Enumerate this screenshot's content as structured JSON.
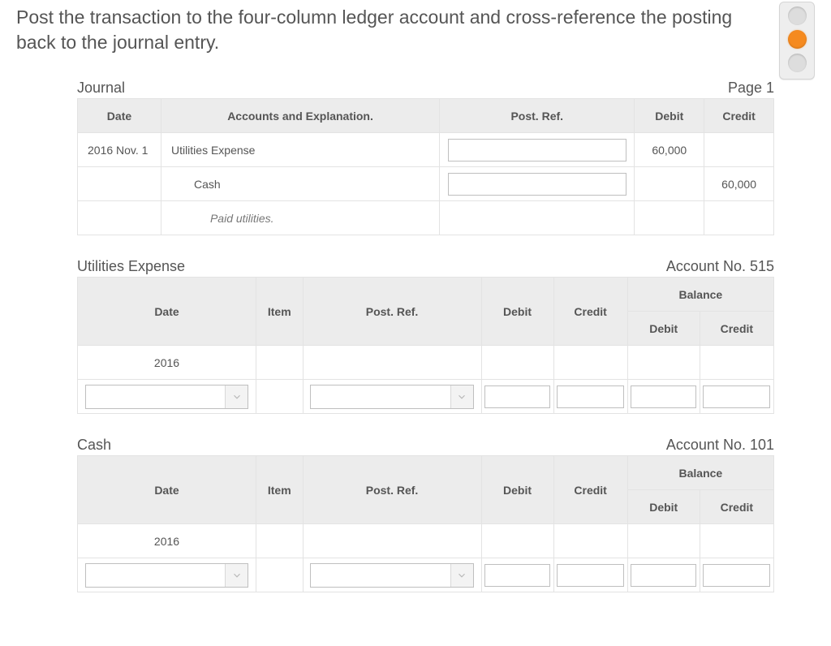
{
  "instruction": "Post the transaction to the four-column ledger account and cross-reference the posting back to the journal entry.",
  "traffic": {
    "active": "orange"
  },
  "journal": {
    "title": "Journal",
    "page_label": "Page 1",
    "headers": {
      "date": "Date",
      "accounts": "Accounts and Explanation.",
      "post_ref": "Post. Ref.",
      "debit": "Debit",
      "credit": "Credit"
    },
    "rows": [
      {
        "date": "2016 Nov. 1",
        "account": "Utilities Expense",
        "post_ref": "",
        "debit": "60,000",
        "credit": ""
      },
      {
        "date": "",
        "account": "Cash",
        "post_ref": "",
        "debit": "",
        "credit": "60,000"
      },
      {
        "date": "",
        "account": "Paid utilities.",
        "post_ref": "",
        "debit": "",
        "credit": ""
      }
    ]
  },
  "ledgers": [
    {
      "title": "Utilities Expense",
      "account_no_label": "Account No. 515",
      "headers": {
        "date": "Date",
        "item": "Item",
        "post_ref": "Post. Ref.",
        "debit": "Debit",
        "credit": "Credit",
        "balance": "Balance",
        "bal_debit": "Debit",
        "bal_credit": "Credit"
      },
      "year_row": "2016",
      "input_row": {
        "date": "",
        "item": "",
        "post_ref": "",
        "debit": "",
        "credit": "",
        "bal_debit": "",
        "bal_credit": ""
      }
    },
    {
      "title": "Cash",
      "account_no_label": "Account No. 101",
      "headers": {
        "date": "Date",
        "item": "Item",
        "post_ref": "Post. Ref.",
        "debit": "Debit",
        "credit": "Credit",
        "balance": "Balance",
        "bal_debit": "Debit",
        "bal_credit": "Credit"
      },
      "year_row": "2016",
      "input_row": {
        "date": "",
        "item": "",
        "post_ref": "",
        "debit": "",
        "credit": "",
        "bal_debit": "",
        "bal_credit": ""
      }
    }
  ]
}
